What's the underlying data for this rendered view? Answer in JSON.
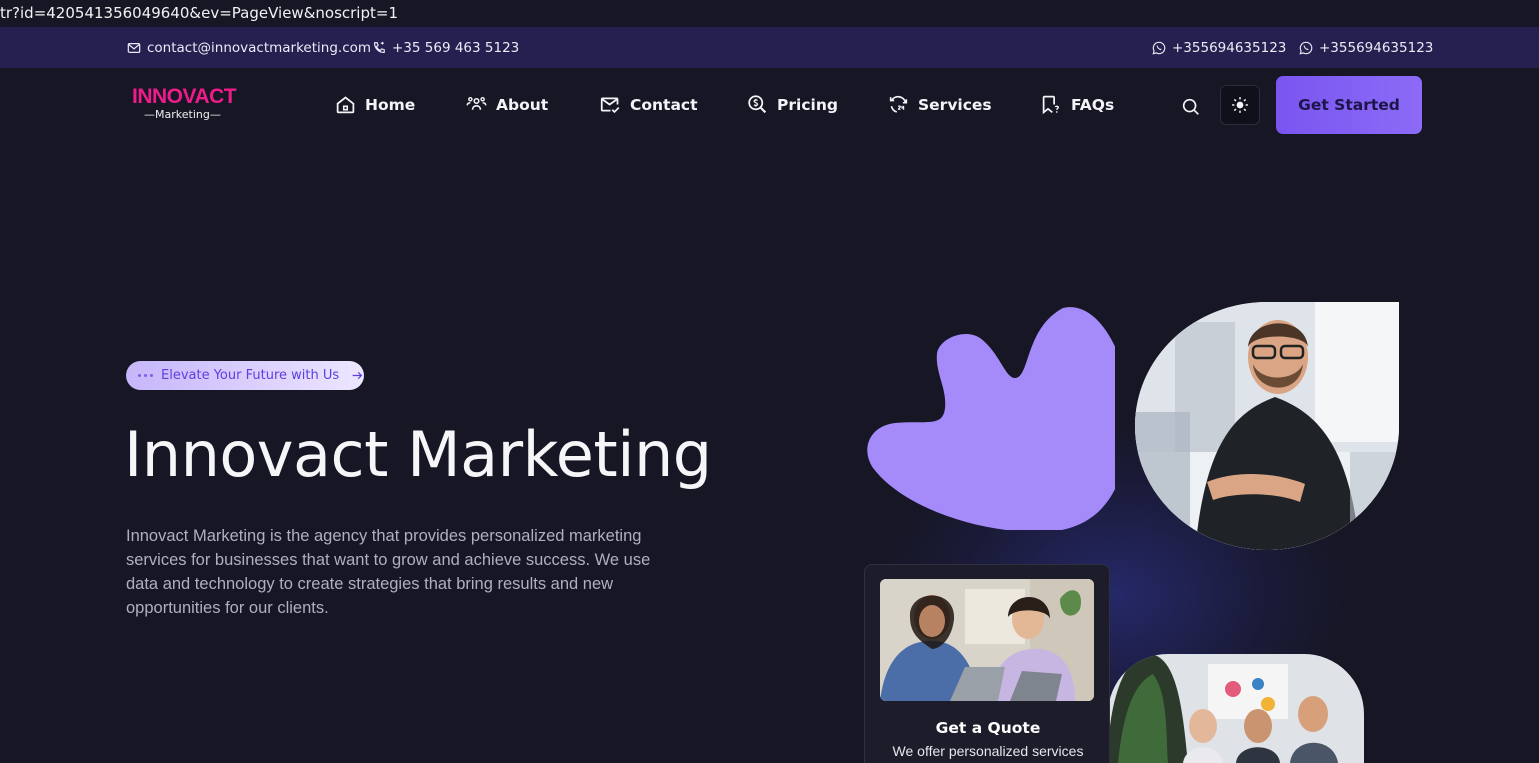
{
  "url_strip": "tr?id=420541356049640&ev=PageView&noscript=1",
  "topbar": {
    "email": "contact@innovactmarketing.com",
    "phone": "+35 569 463 5123",
    "whatsapp_1": "+355694635123",
    "whatsapp_2": "+355694635123"
  },
  "logo": {
    "line1": "INNOVACT",
    "line2": "—Marketing—"
  },
  "nav": {
    "items": [
      {
        "label": "Home",
        "icon": "home-icon"
      },
      {
        "label": "About",
        "icon": "users-icon"
      },
      {
        "label": "Contact",
        "icon": "mail-check-icon"
      },
      {
        "label": "Pricing",
        "icon": "dollar-search-icon"
      },
      {
        "label": "Services",
        "icon": "clock-24-icon"
      },
      {
        "label": "FAQs",
        "icon": "bookmark-question-icon"
      }
    ],
    "cta_label": "Get Started"
  },
  "hero": {
    "pill_text": "Elevate Your Future with Us",
    "title": "Innovact Marketing",
    "description": "Innovact Marketing is the agency that provides personalized marketing services for businesses that want to grow and achieve success. We use data and technology to create strategies that bring results and new opportunities for our clients."
  },
  "quote_card": {
    "title": "Get a Quote",
    "description": "We offer personalized services"
  },
  "colors": {
    "background": "#161624",
    "topbar": "#25204f",
    "accent": "#7a55f0",
    "blob": "#a48bf9",
    "logo": "#ee1c8a"
  }
}
